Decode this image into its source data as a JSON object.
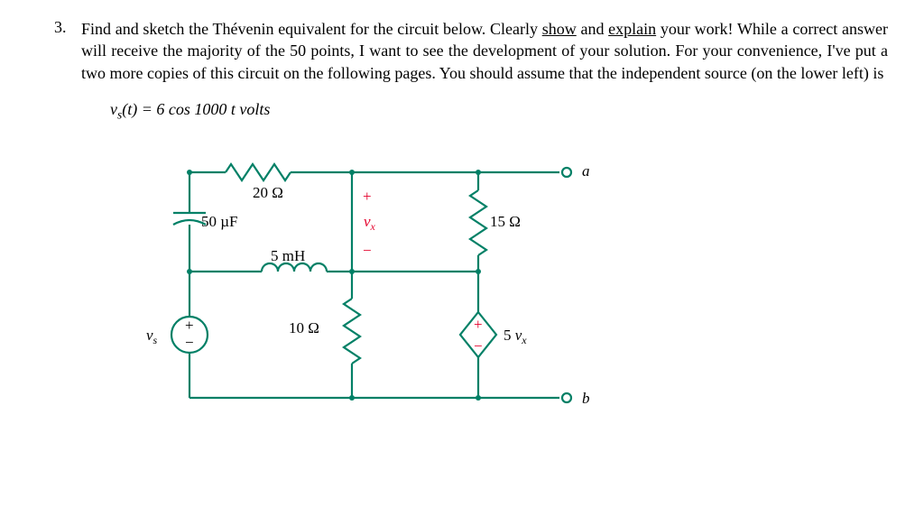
{
  "problem": {
    "number": "3.",
    "sentence_part1": "Find and sketch the Thévenin equivalent for the circuit below. Clearly ",
    "show_word": "show",
    "sentence_part2": " and ",
    "explain_word": "explain",
    "sentence_part3": " your work! While a correct answer will receive the majority of the 50 points, I want to see the development of your solution. For your convenience, I've put a two more copies of this circuit on the following pages. You should assume that the independent source (on the lower left) is"
  },
  "equation": {
    "lhs_var": "v",
    "lhs_sub": "s",
    "lhs_arg": "(t) = 6 cos 1000 t volts"
  },
  "circuit": {
    "R1": "20 Ω",
    "R2": "15 Ω",
    "R3": "10 Ω",
    "L1": "5 mH",
    "C1": "50 µF",
    "vsrc": "v",
    "vsrc_sub": "s",
    "vx_label": "v",
    "vx_sub": "x",
    "dep_gain": "5 ",
    "dep_var": "v",
    "dep_sub": "x",
    "term_a": "a",
    "term_b": "b",
    "plus": "+",
    "minus": "−"
  }
}
